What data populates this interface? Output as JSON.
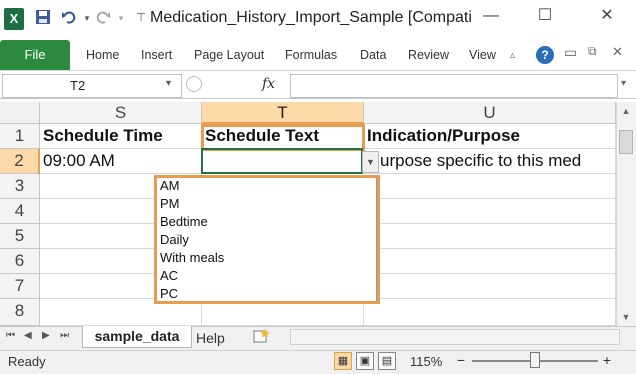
{
  "window": {
    "title": "Medication_History_Import_Sample  [Compati",
    "app_logo": "X",
    "controls": {
      "minimize": "—",
      "maximize": "☐",
      "close": "✕"
    },
    "accent_color": "#217346"
  },
  "qat": {
    "save_icon": "save-icon",
    "undo_icon": "undo-icon",
    "redo_icon": "redo-icon",
    "customize_icon": "customize-qat-icon"
  },
  "ribbon": {
    "file": "File",
    "tabs": [
      "Home",
      "Insert",
      "Page Layout",
      "Formulas",
      "Data",
      "Review",
      "View"
    ],
    "help_icon": "?"
  },
  "formula_bar": {
    "name_box": "T2",
    "fx": "fx",
    "value": ""
  },
  "grid": {
    "columns": [
      "S",
      "T",
      "U"
    ],
    "selected_column": "T",
    "rows": [
      "1",
      "2",
      "3",
      "4",
      "5",
      "6",
      "7",
      "8"
    ],
    "selected_row": "2",
    "row1": {
      "S": "Schedule Time",
      "T": "Schedule Text",
      "U": "Indication/Purpose"
    },
    "row2": {
      "S": "09:00 AM",
      "T": "",
      "U": "urpose specific to this med"
    }
  },
  "dropdown": {
    "options": [
      "AM",
      "PM",
      "Bedtime",
      "Daily",
      "With meals",
      "AC",
      "PC"
    ],
    "highlight_color": "#e99b4f"
  },
  "sheet_tabs": {
    "active": "sample_data",
    "other": "Help",
    "new_sheet_icon": "new-sheet-icon"
  },
  "status": {
    "text": "Ready",
    "zoom": "115%",
    "zoom_out": "−",
    "zoom_in": "+"
  }
}
